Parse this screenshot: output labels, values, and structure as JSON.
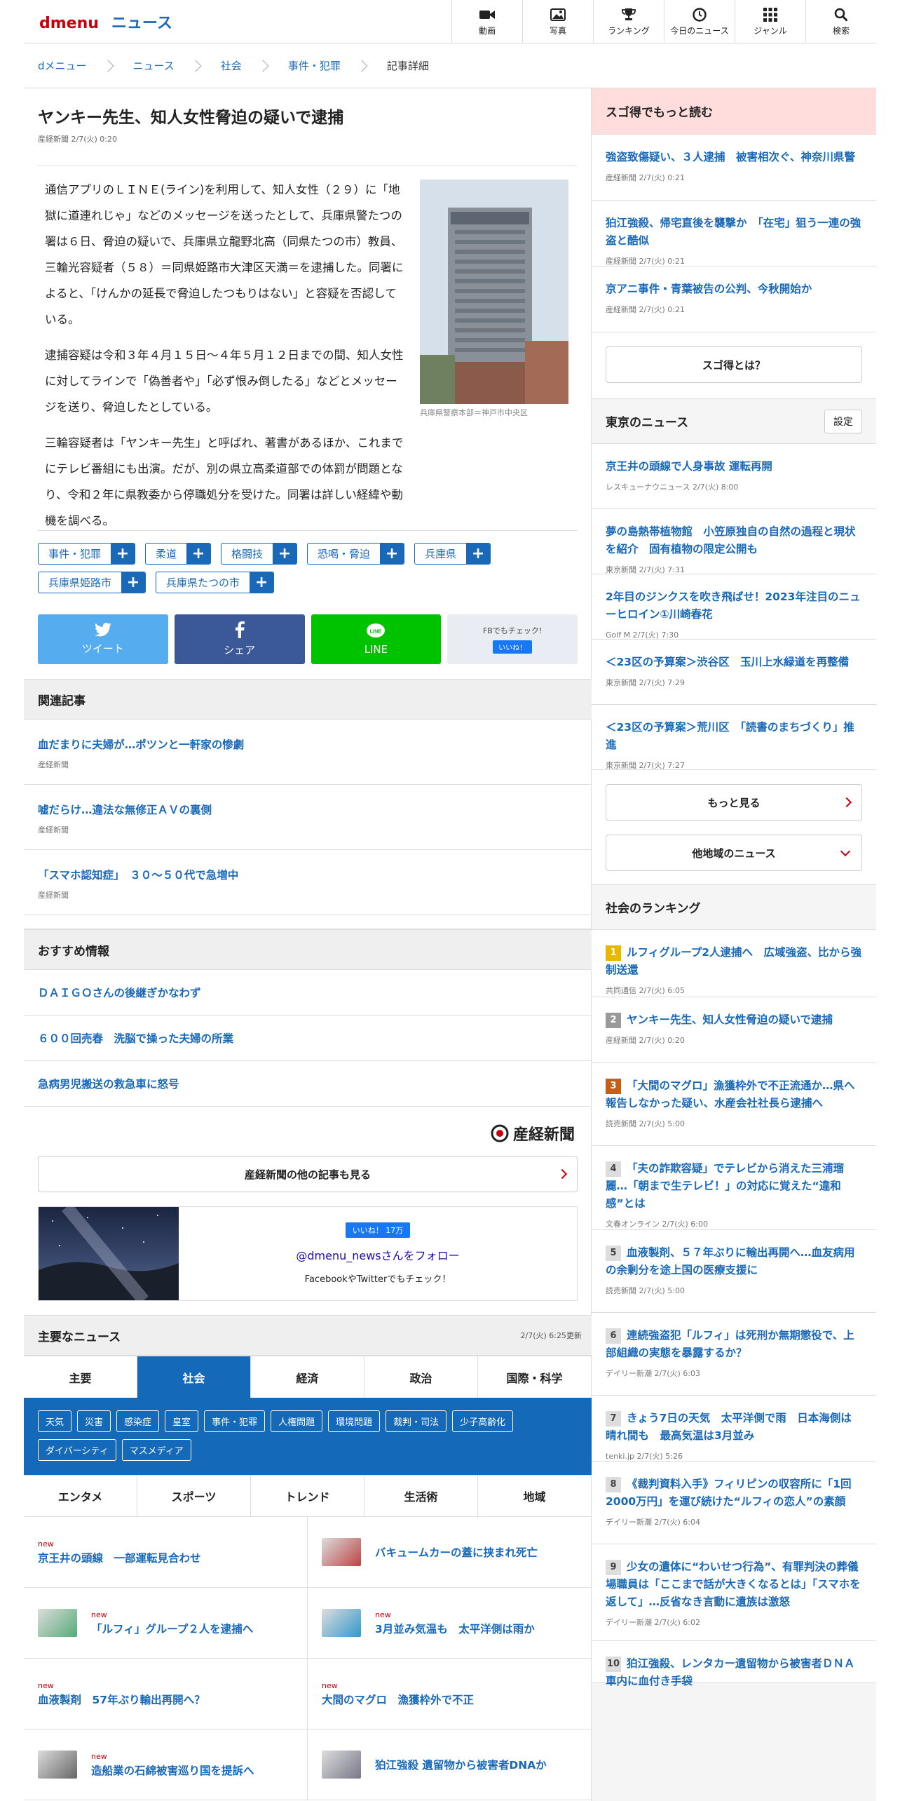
{
  "header": {
    "logo_d": "d",
    "logo_menu": "menu",
    "logo_news": "ニュース",
    "nav": [
      {
        "label": "動画",
        "icon": "video-icon"
      },
      {
        "label": "写真",
        "icon": "photo-icon"
      },
      {
        "label": "ランキング",
        "icon": "trophy-icon"
      },
      {
        "label": "今日のニュース",
        "icon": "clock-icon"
      },
      {
        "label": "ジャンル",
        "icon": "grid-icon"
      },
      {
        "label": "検索",
        "icon": "search-icon"
      }
    ]
  },
  "breadcrumb": [
    "dメニュー",
    "ニュース",
    "社会",
    "事件・犯罪",
    "記事詳細"
  ],
  "article": {
    "title": "ヤンキー先生、知人女性脅迫の疑いで逮捕",
    "meta": "産経新聞 2/7(火) 0:20",
    "paragraphs": [
      "通信アプリのＬＩＮＥ(ライン)を利用して、知人女性（２９）に「地獄に道連れじゃ」などのメッセージを送ったとして、兵庫県警たつの署は６日、脅迫の疑いで、兵庫県立龍野北高（同県たつの市）教員、三輪光容疑者（５８）＝同県姫路市大津区天満＝を逮捕した。同署によると、「けんかの延長で脅迫したつもりはない」と容疑を否認している。",
      "逮捕容疑は令和３年４月１５日〜４年５月１２日までの間、知人女性に対してラインで「偽善者や」「必ず恨み倒したる」などとメッセージを送り、脅迫したとしている。",
      "三輪容疑者は「ヤンキー先生」と呼ばれ、著書があるほか、これまでにテレビ番組にも出演。だが、別の県立高柔道部での体罰が問題となり、令和２年に県教委から停職処分を受けた。同署は詳しい経緯や動機を調べる。"
    ],
    "photo_caption": "兵庫県警察本部＝神戸市中央区",
    "tags": [
      "事件・犯罪",
      "柔道",
      "格闘技",
      "恐喝・脅迫",
      "兵庫県",
      "兵庫県姫路市",
      "兵庫県たつの市"
    ],
    "share": {
      "tweet": "ツイート",
      "share": "シェア",
      "line": "LINE",
      "fb_check": "FBでもチェック!",
      "like": "いいね！"
    }
  },
  "related": {
    "heading": "関連記事",
    "items": [
      {
        "title": "血だまりに夫婦が…ポツンと一軒家の惨劇",
        "source": "産経新聞"
      },
      {
        "title": "嘘だらけ…違法な無修正ＡＶの裏側",
        "source": "産経新聞"
      },
      {
        "title": "「スマホ認知症」　３０〜５０代で急増中",
        "source": "産経新聞"
      }
    ]
  },
  "recommend": {
    "heading": "おすすめ情報",
    "items": [
      "ＤＡＩＧＯさんの後継ぎかなわず",
      "６００回売春　洗脳で操った夫婦の所業",
      "急病男児搬送の救急車に怒号"
    ]
  },
  "publisher": {
    "logo": "産経新聞",
    "more": "産経新聞の他の記事も見る"
  },
  "follow": {
    "likes": "いいね！ 17万",
    "handle": "@dmenu_newsさんをフォロー",
    "note": "FacebookやTwitterでもチェック！"
  },
  "main_news": {
    "heading": "主要なニュース",
    "updated": "2/7(火) 6:25更新",
    "tabs1": [
      "主要",
      "社会",
      "経済",
      "政治",
      "国際・科学"
    ],
    "subtags": [
      "天気",
      "災害",
      "感染症",
      "皇室",
      "事件・犯罪",
      "人権問題",
      "環境問題",
      "裁判・司法",
      "少子高齢化",
      "ダイバーシティ",
      "マスメディア"
    ],
    "tabs2": [
      "エンタメ",
      "スポーツ",
      "トレンド",
      "生活術",
      "地域"
    ],
    "items": [
      {
        "title": "京王井の頭線　一部運転見合わせ",
        "new": "new",
        "thumb": ""
      },
      {
        "title": "バキュームカーの蓋に挟まれ死亡",
        "new": "",
        "thumb": "#b44"
      },
      {
        "title": "「ルフィ」グループ２人を逮捕へ",
        "new": "new",
        "thumb": "#5a7"
      },
      {
        "title": "3月並み気温も　太平洋側は雨か",
        "new": "new",
        "thumb": "#39c"
      },
      {
        "title": "血液製剤　57年ぶり輸出再開へ？",
        "new": "new",
        "thumb": ""
      },
      {
        "title": "大間のマグロ　漁獲枠外で不正",
        "new": "new",
        "thumb": ""
      },
      {
        "title": "造船業の石綿被害巡り国を提訴へ",
        "new": "new",
        "thumb": "#666"
      },
      {
        "title": "狛江強殺 遺留物から被害者DNAか",
        "new": "",
        "thumb": "#778"
      }
    ]
  },
  "sugotoku": {
    "heading": "スゴ得でもっと読む",
    "items": [
      {
        "title": "強盗致傷疑い、３人逮捕　被害相次ぐ、神奈川県警",
        "meta": "産経新聞 2/7(火) 0:21"
      },
      {
        "title": "狛江強殺、帰宅直後を襲撃か　「在宅」狙う一連の強盗と酷似",
        "meta": "産経新聞 2/7(火) 0:21"
      },
      {
        "title": "京アニ事件・青葉被告の公判、今秋開始か",
        "meta": "産経新聞 2/7(火) 0:21"
      }
    ],
    "button": "スゴ得とは？"
  },
  "tokyo": {
    "heading": "東京のニュース",
    "setting": "設定",
    "items": [
      {
        "title": "京王井の頭線で人身事故 運転再開",
        "meta": "レスキューナウニュース 2/7(火) 8:00"
      },
      {
        "title": "夢の島熱帯植物館　小笠原独自の自然の過程と現状を紹介　固有植物の限定公開も",
        "meta": "東京新聞 2/7(火) 7:31"
      },
      {
        "title": "2年目のジンクスを吹き飛ばせ！2023年注目のニューヒロイン①川崎春花",
        "meta": "Golf M 2/7(火) 7:30"
      },
      {
        "title": "＜23区の予算案＞渋谷区　玉川上水緑道を再整備",
        "meta": "東京新聞 2/7(火) 7:29"
      },
      {
        "title": "＜23区の予算案＞荒川区　「読書のまちづくり」推進",
        "meta": "東京新聞 2/7(火) 7:27"
      }
    ],
    "more": "もっと見る",
    "other": "他地域のニュース"
  },
  "ranking": {
    "heading": "社会のランキング",
    "items": [
      {
        "rank": "1",
        "title": "ルフィグループ2人逮捕へ　広域強盗、比から強制送還",
        "meta": "共同通信 2/7(火) 6:05",
        "color": "#e8b800"
      },
      {
        "rank": "2",
        "title": "ヤンキー先生、知人女性脅迫の疑いで逮捕",
        "meta": "産経新聞 2/7(火) 0:20",
        "color": "#999"
      },
      {
        "rank": "3",
        "title": "「大間のマグロ」漁獲枠外で不正流通か…県へ報告しなかった疑い、水産会社社長ら逮捕へ",
        "meta": "読売新聞 2/7(火) 5:00",
        "color": "#c0601a"
      },
      {
        "rank": "4",
        "title": "「夫の詐欺容疑」でテレビから消えた三浦瑠麗…「朝まで生テレビ！」の対応に覚えた“違和感”とは",
        "meta": "文春オンライン 2/7(火) 6:00",
        "color": "#aaa"
      },
      {
        "rank": "5",
        "title": "血液製剤、５７年ぶりに輸出再開へ…血友病用の余剰分を途上国の医療支援に",
        "meta": "読売新聞 2/7(火) 5:00",
        "color": "#aaa"
      },
      {
        "rank": "6",
        "title": "連続強盗犯「ルフィ」は死刑か無期懲役で、上部組織の実態を暴露するか？",
        "meta": "デイリー新潮 2/7(火) 6:03",
        "color": "#aaa"
      },
      {
        "rank": "7",
        "title": "きょう7日の天気　太平洋側で雨　日本海側は晴れ間も　最高気温は3月並み",
        "meta": "tenki.jp 2/7(火) 5:26",
        "color": "#aaa"
      },
      {
        "rank": "8",
        "title": "《裁判資料入手》フィリピンの収容所に「1回2000万円」を運び続けた“ルフィの恋人”の素顔",
        "meta": "デイリー新潮 2/7(火) 6:04",
        "color": "#aaa"
      },
      {
        "rank": "9",
        "title": "少女の遺体に“わいせつ行為”、有罪判決の葬儀場職員は「ここまで話が大きくなるとは」「スマホを返して」…反省なき言動に遺族は激怒",
        "meta": "デイリー新潮 2/7(火) 6:02",
        "color": "#aaa"
      },
      {
        "rank": "10",
        "title": "狛江強殺、レンタカー遺留物から被害者ＤＮＡ　車内に血付き手袋",
        "meta": "",
        "color": "#aaa"
      }
    ]
  }
}
